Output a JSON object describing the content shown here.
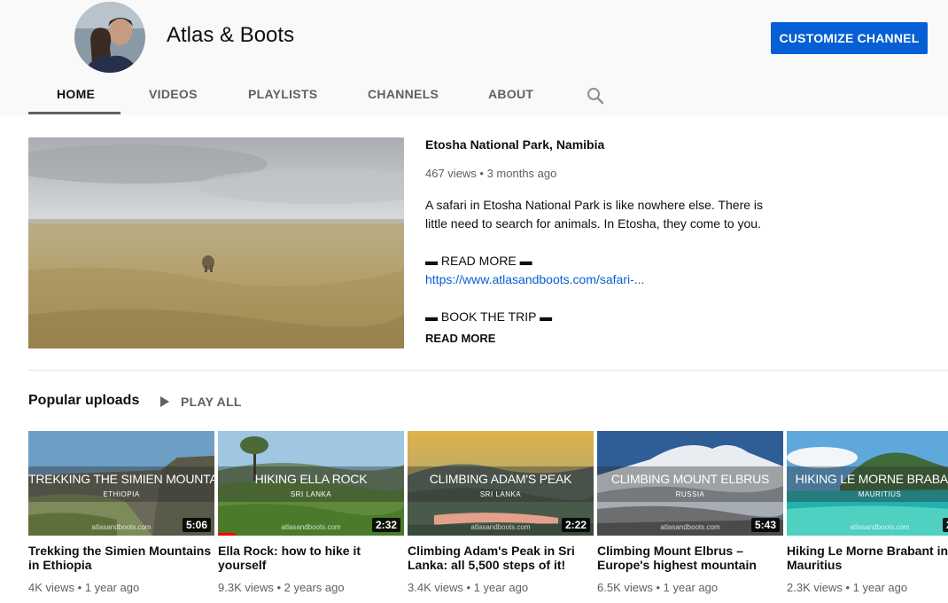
{
  "channel": {
    "name": "Atlas & Boots",
    "customize_label": "CUSTOMIZE CHANNEL"
  },
  "tabs": [
    {
      "label": "HOME",
      "active": true
    },
    {
      "label": "VIDEOS"
    },
    {
      "label": "PLAYLISTS"
    },
    {
      "label": "CHANNELS"
    },
    {
      "label": "ABOUT"
    }
  ],
  "search_icon": "search-icon",
  "featured": {
    "title": "Etosha National Park, Namibia",
    "meta": "467 views • 3 months ago",
    "description": "A safari in Etosha National Park is like nowhere else. There is little need to search for animals. In Etosha, they come to you.",
    "read_more_header": "▬ READ MORE ▬",
    "link": "https://www.atlasandboots.com/safari-...",
    "book_trip": "▬ BOOK THE TRIP ▬",
    "read_more": "READ MORE"
  },
  "shelf": {
    "title": "Popular uploads",
    "play_all": "PLAY ALL",
    "videos": [
      {
        "overlay_title": "TREKKING THE SIMIEN MOUNTAINS",
        "overlay_sub": "ETHIOPIA",
        "brand": "atlasandboots.com",
        "duration": "5:06",
        "title": "Trekking the Simien Mountains in Ethiopia",
        "meta": "4K views • 1 year ago"
      },
      {
        "overlay_title": "HIKING ELLA ROCK",
        "overlay_sub": "SRI LANKA",
        "brand": "atlasandboots.com",
        "duration": "2:32",
        "title": "Ella Rock: how to hike it yourself",
        "meta": "9.3K views • 2 years ago"
      },
      {
        "overlay_title": "CLIMBING ADAM'S PEAK",
        "overlay_sub": "SRI LANKA",
        "brand": "atlasandboots.com",
        "duration": "2:22",
        "title": "Climbing Adam's Peak in Sri Lanka: all 5,500 steps of it!",
        "meta": "3.4K views • 1 year ago"
      },
      {
        "overlay_title": "CLIMBING MOUNT ELBRUS",
        "overlay_sub": "RUSSIA",
        "brand": "atlasandboots.com",
        "duration": "5:43",
        "title": "Climbing Mount Elbrus – Europe's highest mountain",
        "meta": "6.5K views • 1 year ago"
      },
      {
        "overlay_title": "HIKING LE MORNE BRABANT",
        "overlay_sub": "MAURITIUS",
        "brand": "atlasandboots.com",
        "duration": "2",
        "title": "Hiking Le Morne Brabant in Mauritius",
        "meta": "2.3K views • 1 year ago"
      }
    ]
  }
}
